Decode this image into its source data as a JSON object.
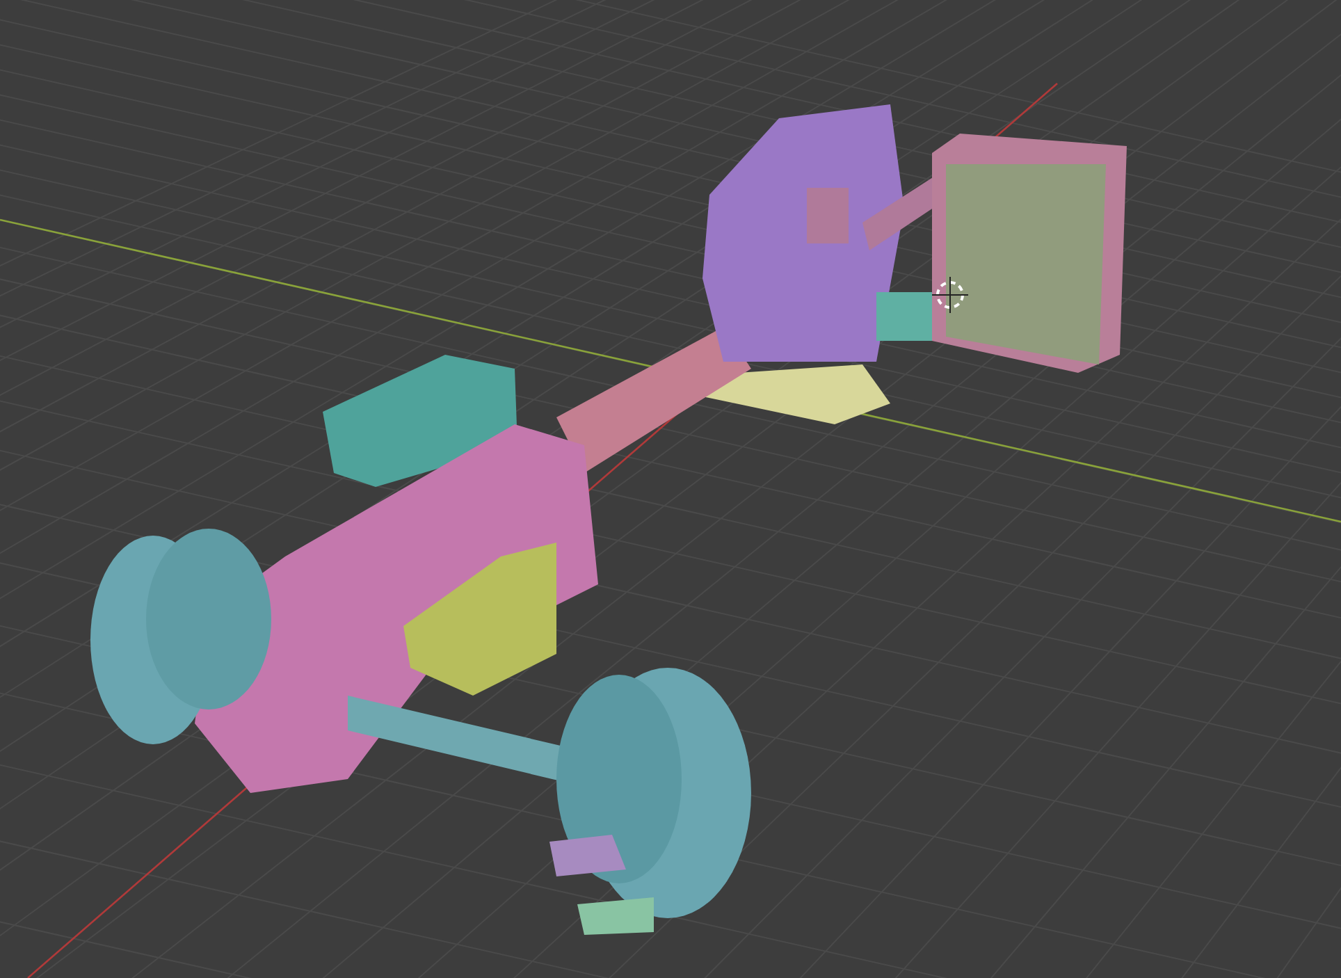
{
  "viewport": {
    "show_grid": true,
    "show_axes": true,
    "show_3d_cursor": true,
    "show_model": true
  }
}
